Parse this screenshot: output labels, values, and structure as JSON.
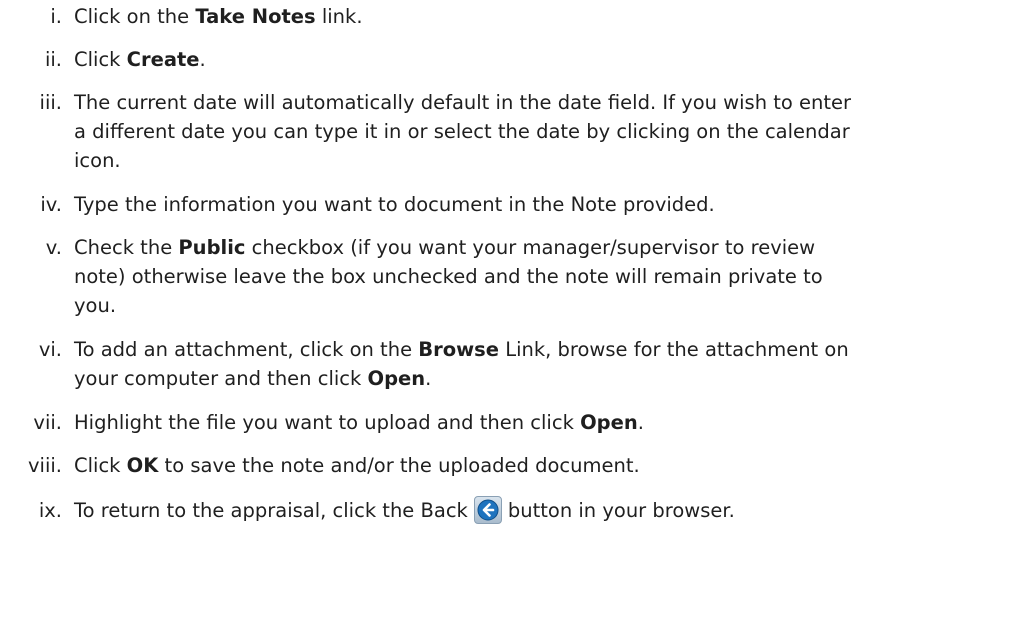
{
  "steps": [
    {
      "numeral": "i.",
      "parts": [
        {
          "t": "Click on the ",
          "b": false
        },
        {
          "t": "Take Notes",
          "b": true
        },
        {
          "t": " link.",
          "b": false
        }
      ]
    },
    {
      "numeral": "ii.",
      "parts": [
        {
          "t": "Click ",
          "b": false
        },
        {
          "t": "Create",
          "b": true
        },
        {
          "t": ".",
          "b": false
        }
      ]
    },
    {
      "numeral": "iii.",
      "lines": [
        "The current date will automatically default in the date field. If you wish to enter",
        "a different date you can type it in or select the date by clicking on the calendar",
        "icon."
      ]
    },
    {
      "numeral": "iv.",
      "lines": [
        "Type the information you want to document in the Note provided."
      ]
    },
    {
      "numeral": "v.",
      "line1": [
        {
          "t": "Check the ",
          "b": false
        },
        {
          "t": "Public",
          "b": true
        },
        {
          "t": " checkbox (if you want your manager/supervisor to review",
          "b": false
        }
      ],
      "line2": "note) otherwise leave the box unchecked and the note will remain private to",
      "line3": "you."
    },
    {
      "numeral": "vi.",
      "line1": [
        {
          "t": "To add an attachment, click on the ",
          "b": false
        },
        {
          "t": "Browse",
          "b": true
        },
        {
          "t": " Link, browse for the attachment on",
          "b": false
        }
      ],
      "line2": [
        {
          "t": "your computer and then click ",
          "b": false
        },
        {
          "t": "Open",
          "b": true
        },
        {
          "t": ".",
          "b": false
        }
      ]
    },
    {
      "numeral": "vii.",
      "parts": [
        {
          "t": "Highlight the file you want to upload and then click ",
          "b": false
        },
        {
          "t": "Open",
          "b": true
        },
        {
          "t": ".",
          "b": false
        }
      ]
    },
    {
      "numeral": "viii.",
      "parts": [
        {
          "t": "Click ",
          "b": false
        },
        {
          "t": "OK",
          "b": true
        },
        {
          "t": " to save the note and/or the uploaded document.",
          "b": false
        }
      ]
    },
    {
      "numeral": "ix.",
      "before_icon": "To return to the appraisal, click the Back",
      "icon": "back-arrow-icon",
      "after_icon": "button in your browser."
    }
  ],
  "colors": {
    "text": "#1f1f1f",
    "icon_arrow": "#1e73be"
  }
}
